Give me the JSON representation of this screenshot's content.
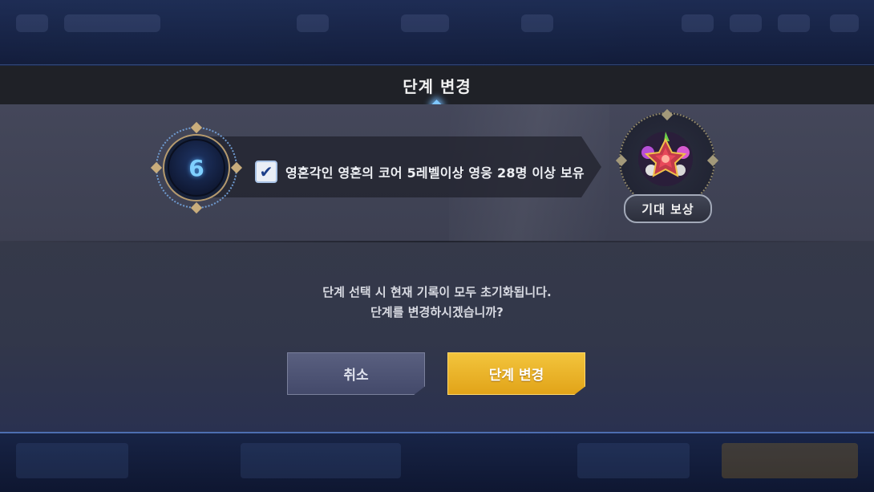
{
  "modal": {
    "title": "단계 변경",
    "level": "6",
    "condition": {
      "checked": true,
      "text": "영혼각인 영혼의 코어 5레벨이상 영웅 28명 이상 보유"
    },
    "reward_label": "기대 보상",
    "message_line1": "단계 선택 시 현재 기록이 모두 초기화됩니다.",
    "message_line2": "단계를 변경하시겠습니까?",
    "cancel_label": "취소",
    "confirm_label": "단계 변경"
  },
  "colors": {
    "confirm_button": "#f0b92c",
    "cancel_button": "#4f5576",
    "header_bar": "#1f2127",
    "level_number": "#7fd0ff"
  },
  "icons": {
    "check": "check-icon",
    "reward": "reward-star-icon"
  }
}
